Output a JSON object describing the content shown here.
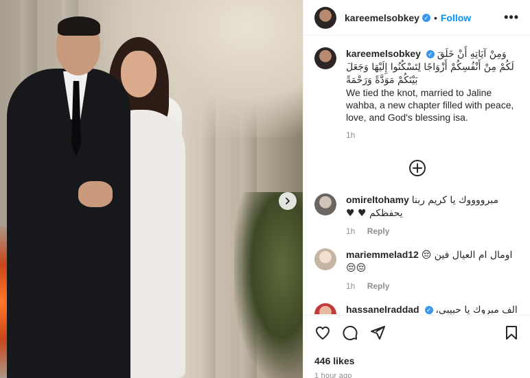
{
  "post": {
    "username": "kareemelsobkey",
    "follow_label": "Follow",
    "dot": "•",
    "more": "•••"
  },
  "caption": {
    "username": "kareemelsobkey",
    "arabic": "وَمِنْ آيَاتِهِ أَنْ خَلَقَ لَكُمْ مِنْ أَنْفُسِكُمْ أَزْوَاجًا لِتَسْكُنُوا إِلَيْهَا وَجَعَلَ بَيْنَكُمْ مَوَدَّةً وَرَحْمَةً",
    "text": "We tied the knot, married to Jaline wahba, a new chapter filled with peace, love, and God's blessing isa.",
    "time": "1h"
  },
  "comments": [
    {
      "username": "omireltohamy",
      "text": "مبرووووك يا كريم ربنا يحفظكم ♥ ♥",
      "time": "1h",
      "reply": "Reply"
    },
    {
      "username": "mariemmelad12",
      "text": "اومال ام العيال فين 😔😔😔",
      "time": "1h",
      "reply": "Reply"
    },
    {
      "username": "hassanelraddad",
      "text": "الف مبروك يا حبيبي، ربنا",
      "time": "",
      "reply": ""
    }
  ],
  "footer": {
    "likes": "446 likes",
    "time_ago": "1 hour ago"
  },
  "colors": {
    "accent": "#0095f6",
    "verified": "#3897f0"
  },
  "icons": [
    "heart-icon",
    "comment-icon",
    "share-icon",
    "bookmark-icon",
    "add-circle-icon",
    "chevron-right-icon",
    "more-icon",
    "verified-icon"
  ]
}
